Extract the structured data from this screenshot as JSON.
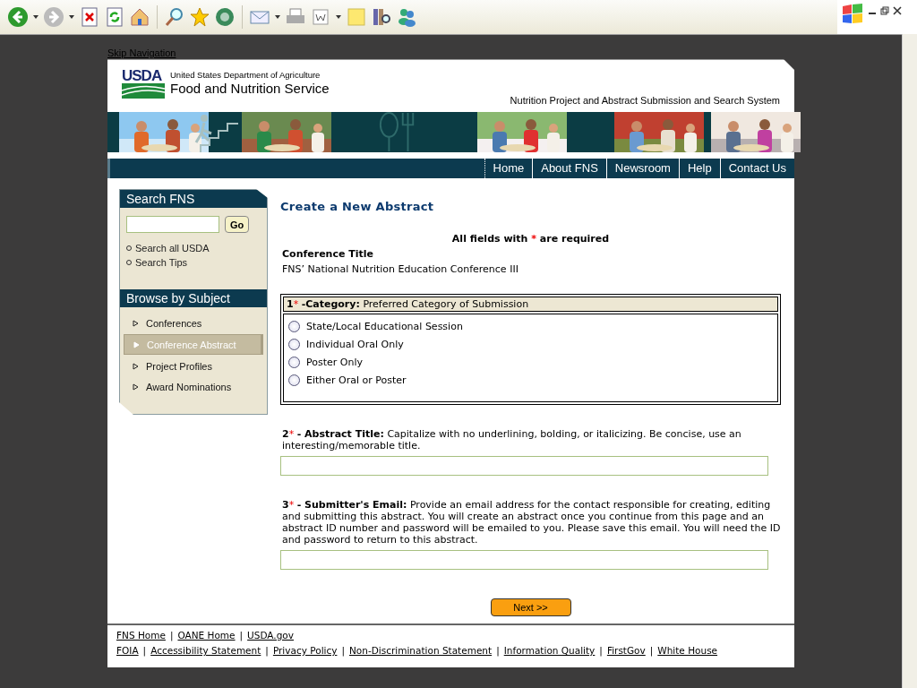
{
  "skip_link": "Skip Navigation",
  "header": {
    "agency_logo": "USDA",
    "department": "United States Department of Agriculture",
    "service": "Food and Nutrition Service",
    "system_title": "Nutrition Project and Abstract Submission and Search System"
  },
  "nav": [
    "Home",
    "About FNS",
    "Newsroom",
    "Help",
    "Contact Us"
  ],
  "sidebar": {
    "search_title": "Search FNS",
    "search_button": "Go",
    "search_links": [
      "Search all USDA",
      "Search Tips"
    ],
    "browse_title": "Browse by Subject",
    "items": [
      {
        "label": "Conferences",
        "selected": false
      },
      {
        "label": "Conference Abstract",
        "selected": true
      },
      {
        "label": "Project Profiles",
        "selected": false
      },
      {
        "label": "Award Nominations",
        "selected": false
      }
    ]
  },
  "page_title": "Create a New Abstract",
  "required_note": {
    "before": "All fields with",
    "mark": "*",
    "after": "are required"
  },
  "conference": {
    "label": "Conference Title",
    "value": "FNS’ National Nutrition Education Conference III"
  },
  "category": {
    "number": "1",
    "mark": "*",
    "label": "-Category:",
    "hint": "Preferred Category of Submission",
    "options": [
      {
        "label": "State/Local Educational Session",
        "selected": false
      },
      {
        "label": "Individual Oral Only",
        "selected": false
      },
      {
        "label": "Poster Only",
        "selected": false
      },
      {
        "label": "Either Oral or Poster",
        "selected": false
      }
    ]
  },
  "fields": [
    {
      "number": "2",
      "mark": "*",
      "label": "- Abstract Title:",
      "hint": "Capitalize with no underlining, bolding, or italicizing. Be concise, use an interesting/memorable title."
    },
    {
      "number": "3",
      "mark": "*",
      "label": "- Submitter's Email:",
      "hint": "Provide an email address for the contact responsible for creating, editing and submitting this abstract. You will create an abstract once you continue from this page and an abstract ID number and password will be emailed to you. Please save this email. You will need the ID and password to return to this abstract."
    }
  ],
  "next_button": "Next >>",
  "footer": [
    [
      {
        "kind": "link",
        "text": "FNS Home"
      },
      {
        "kind": "separator",
        "text": "|"
      },
      {
        "kind": "link",
        "text": "OANE Home"
      },
      {
        "kind": "separator",
        "text": "|"
      },
      {
        "kind": "link",
        "text": "USDA.gov"
      }
    ],
    [
      {
        "kind": "link",
        "text": "FOIA"
      },
      {
        "kind": "separator",
        "text": "|"
      },
      {
        "kind": "link",
        "text": "Accessibility Statement"
      },
      {
        "kind": "separator",
        "text": "|"
      },
      {
        "kind": "link",
        "text": "Privacy Policy"
      },
      {
        "kind": "separator",
        "text": "|"
      },
      {
        "kind": "link",
        "text": "Non-Discrimination Statement"
      },
      {
        "kind": "separator",
        "text": "|"
      },
      {
        "kind": "link",
        "text": "Information Quality"
      },
      {
        "kind": "separator",
        "text": "|"
      },
      {
        "kind": "link",
        "text": "FirstGov"
      },
      {
        "kind": "separator",
        "text": "|"
      },
      {
        "kind": "link",
        "text": "White House"
      }
    ]
  ]
}
